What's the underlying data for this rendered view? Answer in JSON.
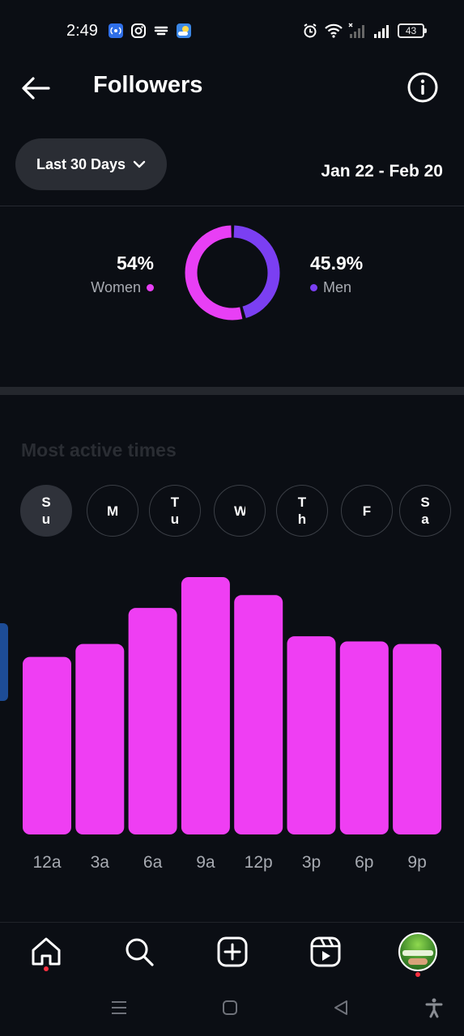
{
  "status_bar": {
    "time": "2:49",
    "battery": "43",
    "left_icons": [
      "hotspot-icon",
      "instagram-icon",
      "vpn-icon",
      "weather-icon"
    ],
    "right_icons": [
      "alarm-icon",
      "wifi-icon",
      "signal-icon",
      "signal-icon"
    ]
  },
  "header": {
    "title": "Followers",
    "back_icon": "back-arrow-icon",
    "info_icon": "info-icon"
  },
  "filter": {
    "range_label": "Last 30 Days",
    "date_range": "Jan 22 - Feb 20"
  },
  "gender": {
    "women_pct": "54%",
    "women_label": "Women",
    "men_pct": "45.9%",
    "men_label": "Men",
    "women_color": "#e83ff5",
    "men_color": "#7b3ff2"
  },
  "active_times": {
    "title": "Most active times",
    "days": [
      "Su",
      "M",
      "Tu",
      "W",
      "Th",
      "F",
      "Sa"
    ],
    "selected_day": "Su"
  },
  "chart_data": {
    "type": "bar",
    "categories": [
      "12a",
      "3a",
      "6a",
      "9a",
      "12p",
      "3p",
      "6p",
      "9p"
    ],
    "values": [
      69,
      74,
      88,
      100,
      93,
      77,
      75,
      74
    ],
    "ylim": [
      0,
      100
    ],
    "color": "#ef3ef3",
    "grid": false
  },
  "bottom_nav": {
    "items": [
      "home-icon",
      "search-icon",
      "create-icon",
      "reels-icon",
      "profile-avatar"
    ]
  },
  "system_nav": {
    "items": [
      "menu-icon",
      "home-square-icon",
      "back-triangle-icon",
      "accessibility-icon"
    ]
  },
  "colors": {
    "background": "#0b0e14",
    "pill": "#2a2d34",
    "muted_text": "#a8abb2"
  }
}
